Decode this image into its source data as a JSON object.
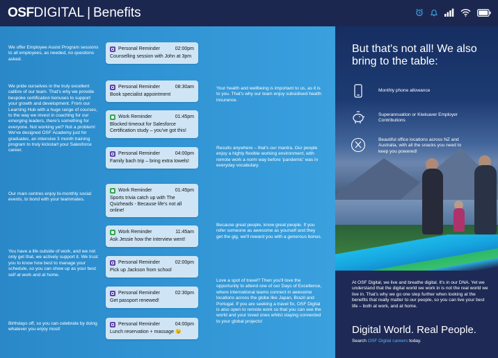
{
  "header": {
    "brand_osf": "OSF",
    "brand_digital": "DIGITAL",
    "brand_sep": "|",
    "brand_benefits": "Benefits",
    "icons": [
      "alarm-icon",
      "bell-icon",
      "signal-icon",
      "wifi-icon",
      "battery-icon"
    ]
  },
  "left_texts": [
    "We offer Employee Assist Program sessions to all employees, as needed, no questions asked.",
    "We pride ourselves in the truly excellent calibre of our team. That's why we provide bespoke certification bonuses to support your growth and development. From our Learning Hub with a huge range of courses, to the way we invest in coaching for our emerging leaders, there's something for everyone. Not working yet? Not a problem! We've designed OSF Academy just for graduates, an intensive 3 month training program to truly kickstart your Salesforce career.",
    "Our main centres enjoy bi-monthly social events, to bond with your teammates.",
    "You have a life outside of work, and we not only get that, we actively support it. We trust you to know how best to manage your schedule, so you can show up as your best self at work and at home.",
    "Birthdays off, so you can celebrate by doing whatever you enjoy most!"
  ],
  "middle_texts": [
    "Your health and wellbeing is important to us, as it is to you. That's why our team enjoy subsidised health insurance.",
    "Results anywhere – that's our mantra. Our people enjoy a highly flexible working environment, with remote work a norm way before 'pandemic' was in everyday vocabulary.",
    "Because great people, know great people. If you refer someone as awesome as yourself and they get the gig, we'll reward you with a generous bonus.",
    "Love a spot of travel? Then you'll love the opportunity to attend one of our Days of Excellence, where international teams connect in awesome locations across the globe like Japan, Brazil and Portugal. If you are seeking a travel fix, OSF Digital is also open to remote work so that you can see the world and your loved ones whilst staying connected to your global projects!"
  ],
  "cards": [
    {
      "type": "Personal Reminder",
      "time": "02:00pm",
      "body": "Counselling session with John at 3pm"
    },
    {
      "type": "Personal Reminder",
      "time": "08:30am",
      "body": "Book specialist appointment"
    },
    {
      "type": "Work Reminder",
      "time": "01:45pm",
      "body": "Blocked timeout for Salesforce Certification study – you've got this!"
    },
    {
      "type": "Personal Reminder",
      "time": "04:00pm",
      "body": "Family bach trip – bring extra towels!"
    },
    {
      "type": "Work Reminder",
      "time": "01:45pm",
      "body": "Sports trivia catch up with The Quizheads - Because life's not all online!"
    },
    {
      "type": "Work Reminder",
      "time": "11:45am",
      "body": "Ask Jessie how the interview went!"
    },
    {
      "type": "Personal Reminder",
      "time": "02:00pm",
      "body": "Pick up Jackson from school"
    },
    {
      "type": "Personal Reminder",
      "time": "02:30pm",
      "body": "Get passport renewed!"
    },
    {
      "type": "Personal Reminder",
      "time": "04:00pm",
      "body": "Lunch reservation + massage 😉"
    }
  ],
  "right": {
    "heading": "But that's not all! We also bring to the table:",
    "features": [
      {
        "icon": "phone-icon",
        "text": "Monthly phone allowance"
      },
      {
        "icon": "piggy-bank-icon",
        "text": "Superannuation or Kiwisaver Employer Contributions"
      },
      {
        "icon": "cutlery-icon",
        "text": "Beautiful office locations across NZ and Australia, with all the snacks you need to keep you powered!"
      }
    ],
    "bottom_para": "At OSF Digital, we live and breathe digital. It's in our DNA. Yet we understand that the digital world we work in is not the real world we live in. That's why we go one step further when looking at the benefits that really matter to our people, so you can live your best life – both at work, and at home.",
    "tagline": "Digital World. Real People.",
    "search_pre": "Search ",
    "search_link": "OSF Digital careers",
    "search_post": " today."
  },
  "colors": {
    "header_bg": "#1c2750",
    "left_bg": "#2f92d2",
    "card_bg": "#cfe5f5",
    "personal_icon": "#5b3fa8",
    "work_icon": "#2fa84a",
    "link": "#55b4ee"
  }
}
